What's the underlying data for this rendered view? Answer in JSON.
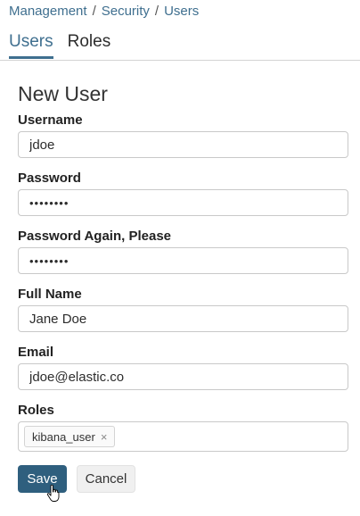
{
  "breadcrumb": {
    "items": [
      "Management",
      "Security",
      "Users"
    ],
    "separator": "/"
  },
  "tabs": [
    {
      "label": "Users",
      "active": true
    },
    {
      "label": "Roles",
      "active": false
    }
  ],
  "form": {
    "title": "New User",
    "username": {
      "label": "Username",
      "value": "jdoe"
    },
    "password": {
      "label": "Password",
      "value": "••••••••"
    },
    "password_again": {
      "label": "Password Again, Please",
      "value": "••••••••"
    },
    "full_name": {
      "label": "Full Name",
      "value": "Jane Doe"
    },
    "email": {
      "label": "Email",
      "value": "jdoe@elastic.co"
    },
    "roles": {
      "label": "Roles",
      "chips": [
        "kibana_user"
      ],
      "remove_glyph": "×"
    }
  },
  "buttons": {
    "save": "Save",
    "cancel": "Cancel"
  },
  "colors": {
    "accent": "#3f6f8f",
    "primary_button": "#2f5f7e"
  },
  "icons": {
    "cursor": "hand-pointer-icon",
    "chip_remove": "close-icon"
  }
}
